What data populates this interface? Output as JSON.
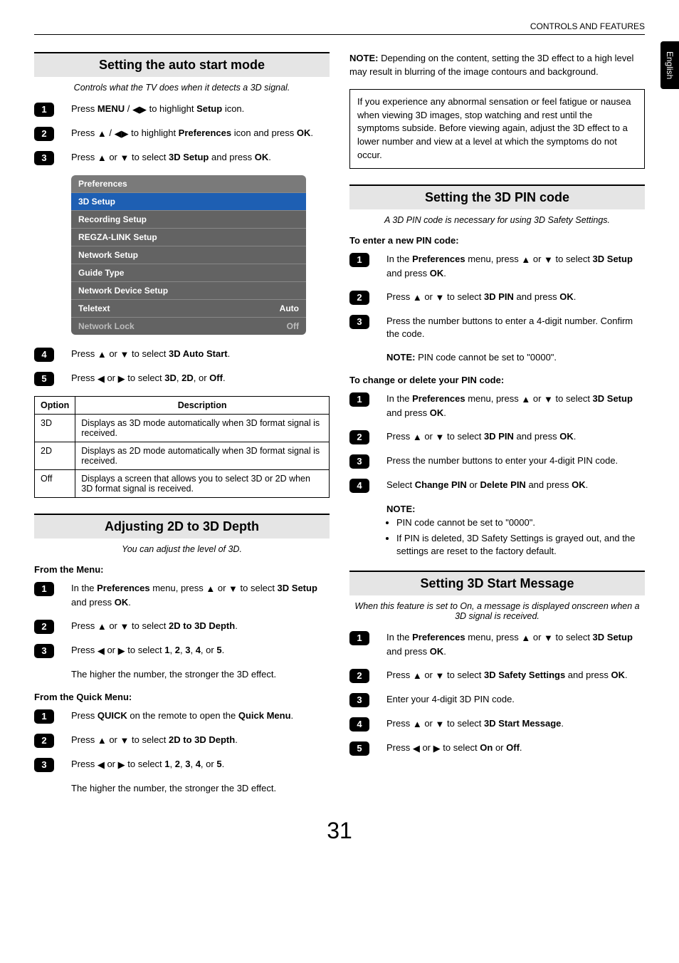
{
  "header": {
    "title": "CONTROLS AND FEATURES"
  },
  "side_tab": "English",
  "page_number": "31",
  "left": {
    "sec1": {
      "heading": "Setting the auto start mode",
      "intro": "Controls what the TV does when it detects a 3D signal.",
      "step1_a": "Press ",
      "step1_b": "MENU",
      "step1_c": " / ",
      "step1_d": " to highlight ",
      "step1_e": "Setup",
      "step1_f": " icon.",
      "step2_a": "Press ",
      "step2_b": " / ",
      "step2_c": " to highlight ",
      "step2_d": "Preferences",
      "step2_e": " icon and press ",
      "step2_f": "OK",
      "step2_g": ".",
      "step3_a": "Press ",
      "step3_b": " or ",
      "step3_c": " to select ",
      "step3_d": "3D Setup",
      "step3_e": " and press ",
      "step3_f": "OK",
      "step3_g": ".",
      "prefs": {
        "title": "Preferences",
        "rows": [
          {
            "label": "3D Setup",
            "sel": true
          },
          {
            "label": "Recording Setup"
          },
          {
            "label": "REGZA-LINK Setup"
          },
          {
            "label": "Network Setup"
          },
          {
            "label": "Guide Type"
          },
          {
            "label": "Network Device Setup"
          },
          {
            "label": "Teletext",
            "value": "Auto"
          },
          {
            "label": "Network Lock",
            "value": "Off",
            "dim": true
          }
        ]
      },
      "step4_a": "Press ",
      "step4_b": " or ",
      "step4_c": " to select ",
      "step4_d": "3D Auto Start",
      "step4_e": ".",
      "step5_a": "Press ",
      "step5_b": " or ",
      "step5_c": " to select ",
      "step5_d": "3D",
      "step5_e": ", ",
      "step5_f": "2D",
      "step5_g": ", or ",
      "step5_h": "Off",
      "step5_i": ".",
      "table": {
        "h1": "Option",
        "h2": "Description",
        "rows": [
          {
            "opt": "3D",
            "desc": "Displays as 3D mode automatically when 3D format signal is received."
          },
          {
            "opt": "2D",
            "desc": "Displays as 2D mode automatically when 3D format signal is received."
          },
          {
            "opt": "Off",
            "desc": "Displays a screen that allows you to select 3D or 2D when 3D format signal is received."
          }
        ]
      }
    },
    "sec2": {
      "heading": "Adjusting 2D to 3D Depth",
      "intro": "You can adjust the level of 3D.",
      "sub1": "From the Menu:",
      "s1_1a": "In the ",
      "s1_1b": "Preferences",
      "s1_1c": " menu, press ",
      "s1_1d": " or ",
      "s1_1e": " to select ",
      "s1_1f": "3D Setup",
      "s1_1g": " and press ",
      "s1_1h": "OK",
      "s1_1i": ".",
      "s1_2a": "Press ",
      "s1_2b": " or ",
      "s1_2c": " to select ",
      "s1_2d": "2D to 3D Depth",
      "s1_2e": ".",
      "s1_3a": "Press ",
      "s1_3b": " or ",
      "s1_3c": " to select ",
      "s1_3d": "1",
      "s1_3e": ", ",
      "s1_3f": "2",
      "s1_3g": ", ",
      "s1_3h": "3",
      "s1_3i": ", ",
      "s1_3j": "4",
      "s1_3k": ", or ",
      "s1_3l": "5",
      "s1_3m": ".",
      "s1_note": "The higher the number, the stronger the 3D effect.",
      "sub2": "From the Quick Menu:",
      "s2_1a": "Press ",
      "s2_1b": "QUICK",
      "s2_1c": " on the remote to open the ",
      "s2_1d": "Quick Menu",
      "s2_1e": ".",
      "s2_2a": "Press ",
      "s2_2b": " or ",
      "s2_2c": " to select ",
      "s2_2d": "2D to 3D Depth",
      "s2_2e": ".",
      "s2_3a": "Press ",
      "s2_3b": " or ",
      "s2_3c": " to select ",
      "s2_3d": "1",
      "s2_3e": ", ",
      "s2_3f": "2",
      "s2_3g": ", ",
      "s2_3h": "3",
      "s2_3i": ", ",
      "s2_3j": "4",
      "s2_3k": ", or ",
      "s2_3l": "5",
      "s2_3m": ".",
      "s2_note": "The higher the number, the stronger the 3D effect."
    }
  },
  "right": {
    "note1a": "NOTE:",
    "note1b": " Depending on the content, setting the 3D effect to a high level may result in blurring of the image contours and background.",
    "box": "If you experience any abnormal sensation or feel fatigue or nausea when viewing 3D images, stop watching and rest until the symptoms subside. Before viewing again, adjust the 3D effect to a lower number and view at a level at which the symptoms do not occur.",
    "sec3": {
      "heading": "Setting the 3D PIN code",
      "intro": "A 3D PIN code is necessary for using 3D Safety Settings.",
      "sub1": "To enter a new PIN code:",
      "e1a": "In the ",
      "e1b": "Preferences",
      "e1c": " menu, press ",
      "e1d": " or ",
      "e1e": " to select ",
      "e1f": "3D Setup",
      "e1g": " and press ",
      "e1h": "OK",
      "e1i": ".",
      "e2a": "Press ",
      "e2b": " or ",
      "e2c": " to select ",
      "e2d": "3D PIN",
      "e2e": " and press ",
      "e2f": "OK",
      "e2g": ".",
      "e3": "Press the number buttons to enter a 4-digit number. Confirm the code.",
      "e_note_a": "NOTE:",
      "e_note_b": " PIN code cannot be set to \"0000\".",
      "sub2": "To change or delete your PIN code:",
      "c1a": "In the ",
      "c1b": "Preferences",
      "c1c": " menu, press ",
      "c1d": " or ",
      "c1e": " to select ",
      "c1f": "3D Setup",
      "c1g": " and press ",
      "c1h": "OK",
      "c1i": ".",
      "c2a": "Press ",
      "c2b": " or ",
      "c2c": " to select ",
      "c2d": "3D PIN",
      "c2e": " and press ",
      "c2f": "OK",
      "c2g": ".",
      "c3": "Press the number buttons to enter your 4-digit PIN code.",
      "c4a": "Select ",
      "c4b": "Change PIN",
      "c4c": " or ",
      "c4d": "Delete PIN",
      "c4e": " and press ",
      "c4f": "OK",
      "c4g": ".",
      "c_note_head": "NOTE:",
      "c_note_b1": "PIN code cannot be set to \"0000\".",
      "c_note_b2": "If PIN is deleted, 3D Safety Settings is grayed out, and the settings are reset to the factory default."
    },
    "sec4": {
      "heading": "Setting 3D Start Message",
      "intro": "When this feature is set to On, a message is displayed onscreen when a 3D signal is received.",
      "m1a": "In the ",
      "m1b": "Preferences",
      "m1c": " menu, press ",
      "m1d": " or ",
      "m1e": " to select ",
      "m1f": "3D Setup",
      "m1g": " and press ",
      "m1h": "OK",
      "m1i": ".",
      "m2a": "Press ",
      "m2b": " or ",
      "m2c": " to select ",
      "m2d": "3D Safety Settings",
      "m2e": " and press ",
      "m2f": "OK",
      "m2g": ".",
      "m3": "Enter your 4-digit 3D PIN code.",
      "m4a": "Press ",
      "m4b": " or ",
      "m4c": " to select ",
      "m4d": "3D Start Message",
      "m4e": ".",
      "m5a": "Press ",
      "m5b": " or ",
      "m5c": " to select ",
      "m5d": "On",
      "m5e": " or ",
      "m5f": "Off",
      "m5g": "."
    }
  },
  "arrows": {
    "up": "▲",
    "down": "▼",
    "left": "◀",
    "right": "▶"
  }
}
